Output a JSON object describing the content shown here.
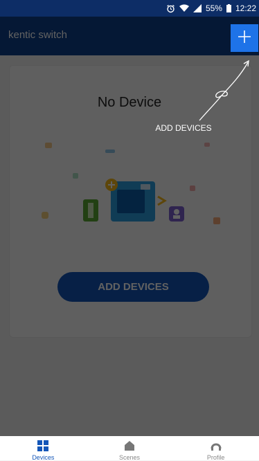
{
  "status": {
    "battery": "55%",
    "time": "12:22"
  },
  "app": {
    "title": "kentic switch"
  },
  "main": {
    "empty_title": "No Device",
    "add_button_label": "ADD DEVICES"
  },
  "hint": {
    "text": "ADD DEVICES"
  },
  "nav": {
    "items": [
      {
        "label": "Devices",
        "icon": "grid-icon",
        "active": true
      },
      {
        "label": "Scenes",
        "icon": "home-icon",
        "active": false
      },
      {
        "label": "Profile",
        "icon": "profile-icon",
        "active": false
      }
    ]
  },
  "colors": {
    "app_bar": "#0f3f8c",
    "accent": "#1e73e8",
    "button": "#1456b8"
  }
}
